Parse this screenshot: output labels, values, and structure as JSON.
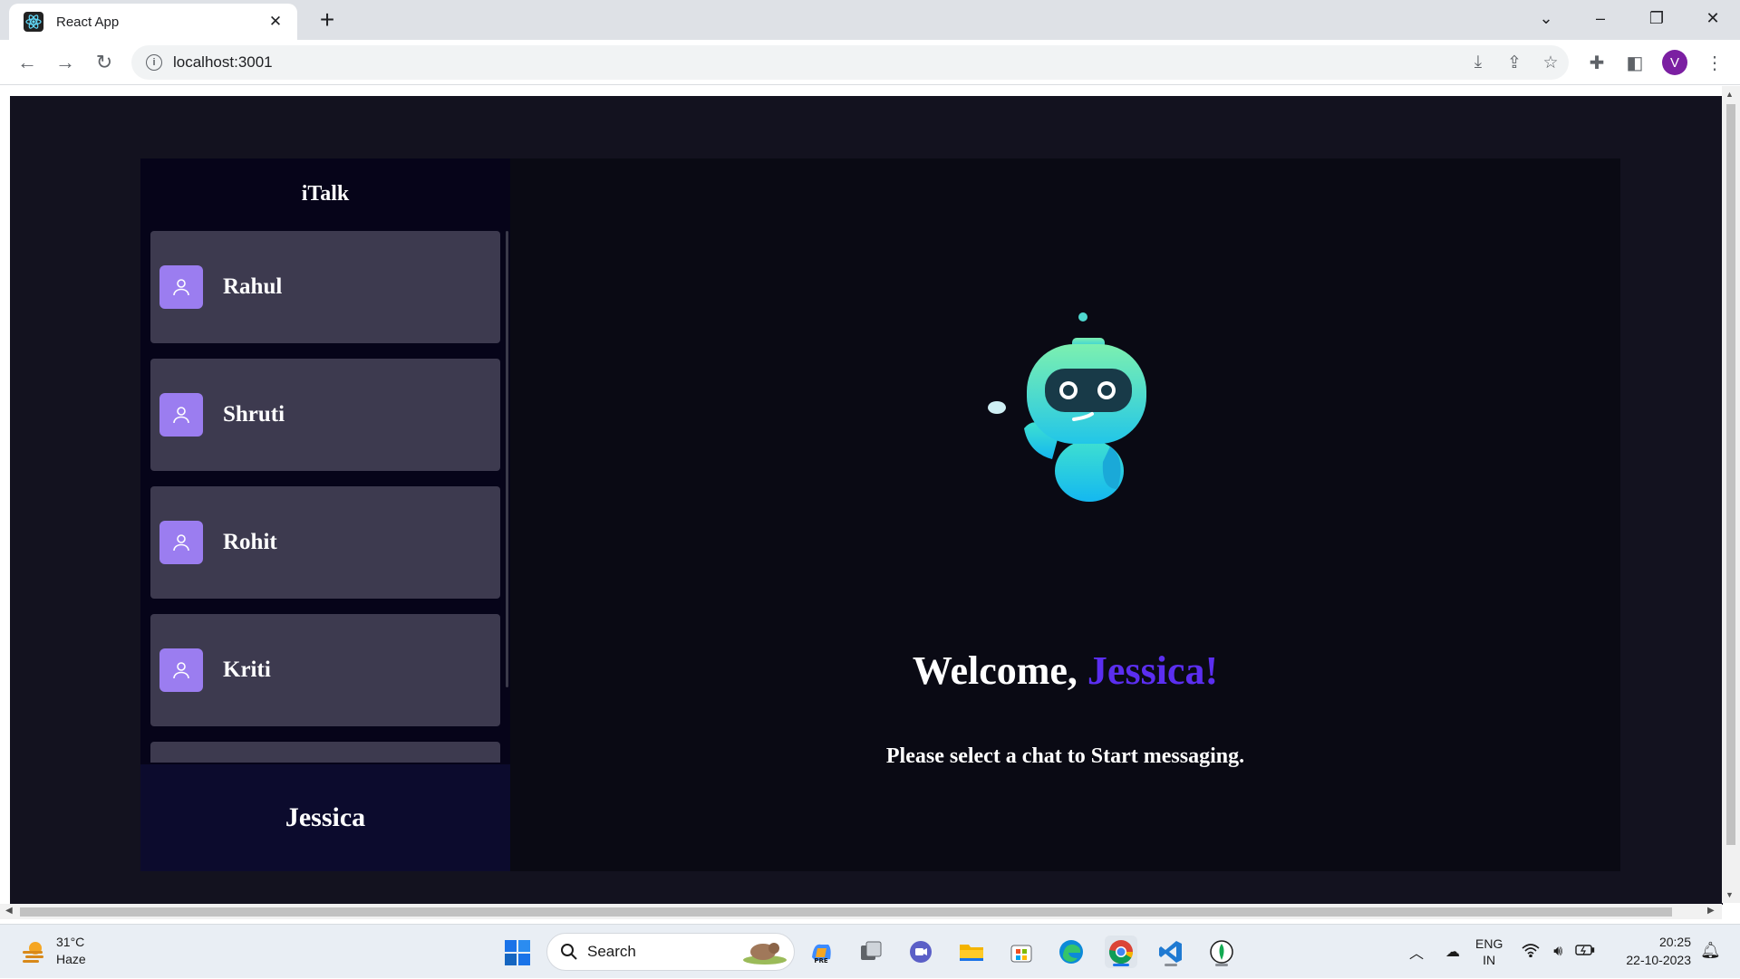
{
  "browser": {
    "tab_title": "React App",
    "url": "localhost:3001",
    "profile_initial": "V"
  },
  "app": {
    "title": "iTalk",
    "contacts": [
      {
        "name": "Rahul"
      },
      {
        "name": "Shruti"
      },
      {
        "name": "Rohit"
      },
      {
        "name": "Kriti"
      },
      {
        "name": ""
      }
    ],
    "current_user": "Jessica",
    "welcome_prefix": "Welcome,",
    "welcome_name": "Jessica!",
    "subtitle": "Please select a chat to Start messaging.",
    "colors": {
      "page_bg": "#13121f",
      "sidebar_bg": "#060419",
      "contact_bg": "#3d3a4f",
      "avatar_bg": "#9b7df0",
      "main_bg": "#0a0a14",
      "accent": "#5b2ef0"
    }
  },
  "taskbar": {
    "weather_temp": "31°C",
    "weather_desc": "Haze",
    "search_label": "Search",
    "lang_top": "ENG",
    "lang_bottom": "IN",
    "time": "20:25",
    "date": "22-10-2023",
    "apps": [
      "copilot-icon",
      "task-view-icon",
      "chat-icon",
      "file-explorer-icon",
      "store-icon",
      "edge-icon",
      "chrome-icon",
      "vscode-icon",
      "mongodb-compass-icon"
    ]
  }
}
